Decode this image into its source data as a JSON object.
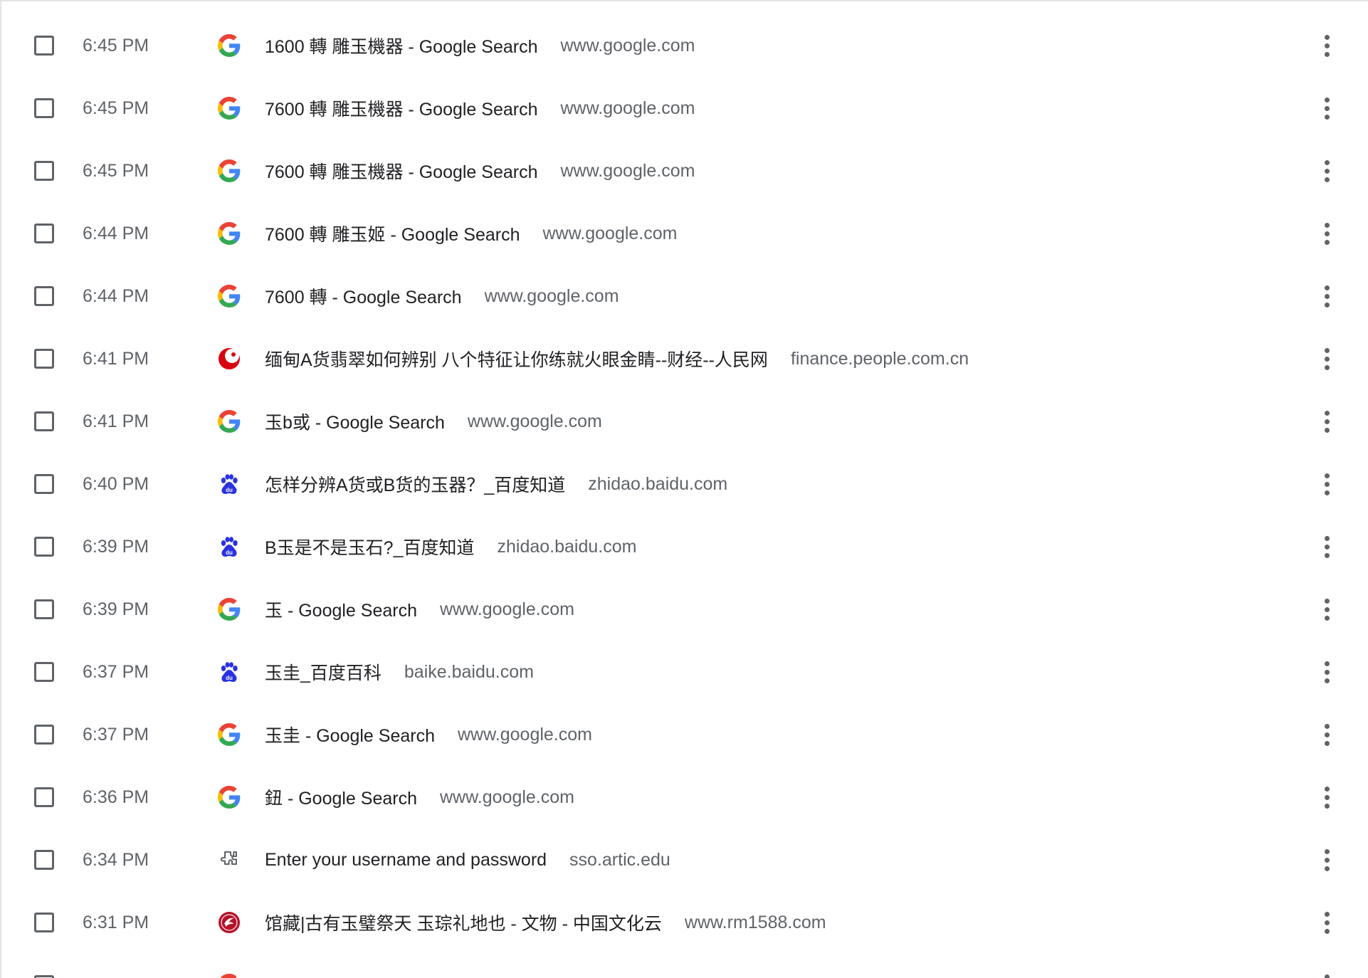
{
  "history": {
    "rows": [
      {
        "time": "6:45 PM",
        "icon": "google-icon",
        "title": "1600 轉 雕玉機器 - Google Search",
        "domain": "www.google.com"
      },
      {
        "time": "6:45 PM",
        "icon": "google-icon",
        "title": "7600 轉 雕玉機器 - Google Search",
        "domain": "www.google.com"
      },
      {
        "time": "6:45 PM",
        "icon": "google-icon",
        "title": "7600 轉 雕玉機器 - Google Search",
        "domain": "www.google.com"
      },
      {
        "time": "6:44 PM",
        "icon": "google-icon",
        "title": "7600 轉 雕玉姬 - Google Search",
        "domain": "www.google.com"
      },
      {
        "time": "6:44 PM",
        "icon": "google-icon",
        "title": "7600 轉 - Google Search",
        "domain": "www.google.com"
      },
      {
        "time": "6:41 PM",
        "icon": "people-daily-icon",
        "title": "缅甸A货翡翠如何辨别 八个特征让你练就火眼金睛--财经--人民网",
        "domain": "finance.people.com.cn"
      },
      {
        "time": "6:41 PM",
        "icon": "google-icon",
        "title": "玉b或 - Google Search",
        "domain": "www.google.com"
      },
      {
        "time": "6:40 PM",
        "icon": "baidu-paw-icon",
        "title": "怎样分辨A货或B货的玉器？_百度知道",
        "domain": "zhidao.baidu.com"
      },
      {
        "time": "6:39 PM",
        "icon": "baidu-paw-icon",
        "title": "B玉是不是玉石?_百度知道",
        "domain": "zhidao.baidu.com"
      },
      {
        "time": "6:39 PM",
        "icon": "google-icon",
        "title": "玉 - Google Search",
        "domain": "www.google.com"
      },
      {
        "time": "6:37 PM",
        "icon": "baidu-paw-icon",
        "title": "玉圭_百度百科",
        "domain": "baike.baidu.com"
      },
      {
        "time": "6:37 PM",
        "icon": "google-icon",
        "title": "玉圭 - Google Search",
        "domain": "www.google.com"
      },
      {
        "time": "6:36 PM",
        "icon": "google-icon",
        "title": "鈕 - Google Search",
        "domain": "www.google.com"
      },
      {
        "time": "6:34 PM",
        "icon": "puzzle-icon",
        "title": "Enter your username and password",
        "domain": "sso.artic.edu"
      },
      {
        "time": "6:31 PM",
        "icon": "rm1588-logo-icon",
        "title": "馆藏|古有玉璧祭天 玉琮礼地也 - 文物 - 中国文化云",
        "domain": "www.rm1588.com"
      },
      {
        "time": "",
        "icon": "google-icon",
        "title": "",
        "domain": ""
      }
    ]
  },
  "colors": {
    "text_primary": "#202124",
    "text_secondary": "#5f6368",
    "baidu_blue": "#2932e1",
    "people_red": "#d7000f"
  }
}
